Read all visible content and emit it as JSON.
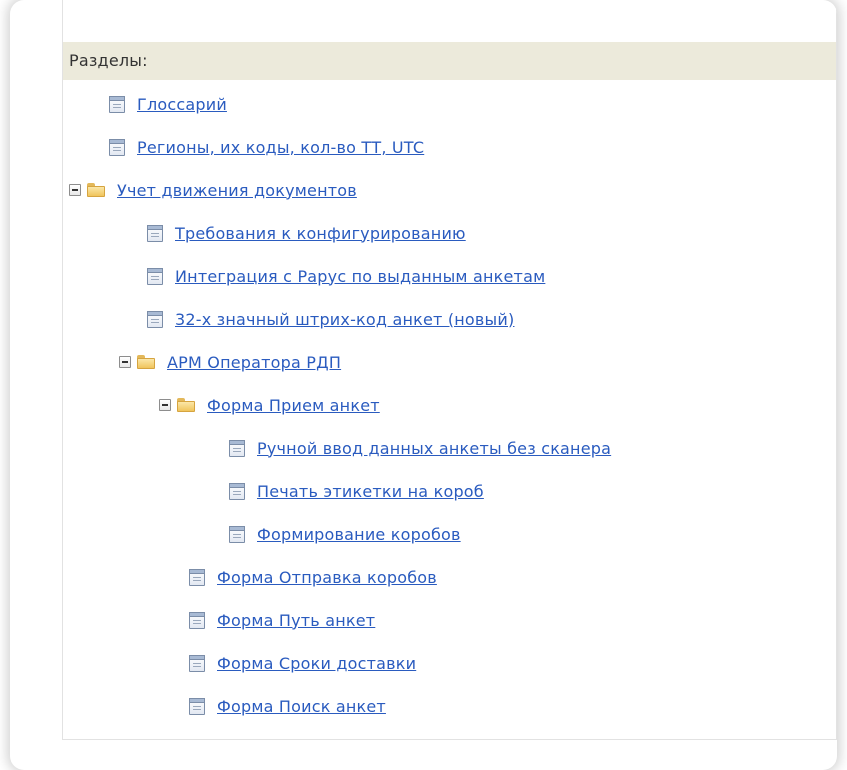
{
  "panel": {
    "header": "Разделы:"
  },
  "tree": [
    {
      "label": "Глоссарий",
      "type": "document"
    },
    {
      "label": "Регионы, их коды, кол-во ТТ, UTC",
      "type": "document"
    },
    {
      "label": "Учет движения документов",
      "type": "folder",
      "expanded": true
    },
    {
      "label": "Требования к конфигурированию",
      "type": "document"
    },
    {
      "label": "Интеграция с Рарус по выданным анкетам",
      "type": "document"
    },
    {
      "label": "32-х значный штрих-код анкет (новый)",
      "type": "document"
    },
    {
      "label": "АРМ Оператора РДП",
      "type": "folder",
      "expanded": true
    },
    {
      "label": "Форма Прием анкет",
      "type": "folder",
      "expanded": true
    },
    {
      "label": "Ручной ввод данных анкеты без сканера",
      "type": "document"
    },
    {
      "label": "Печать этикетки на короб",
      "type": "document"
    },
    {
      "label": "Формирование коробов",
      "type": "document"
    },
    {
      "label": "Форма Отправка коробов",
      "type": "document"
    },
    {
      "label": "Форма Путь анкет",
      "type": "document"
    },
    {
      "label": "Форма Сроки доставки",
      "type": "document"
    },
    {
      "label": "Форма Поиск анкет",
      "type": "document"
    }
  ],
  "icons": {
    "document": "document-icon",
    "folder": "folder-open-icon",
    "collapse": "minus-square-icon"
  },
  "colors": {
    "link": "#2a5bbf",
    "header_bg": "#eceadb"
  }
}
